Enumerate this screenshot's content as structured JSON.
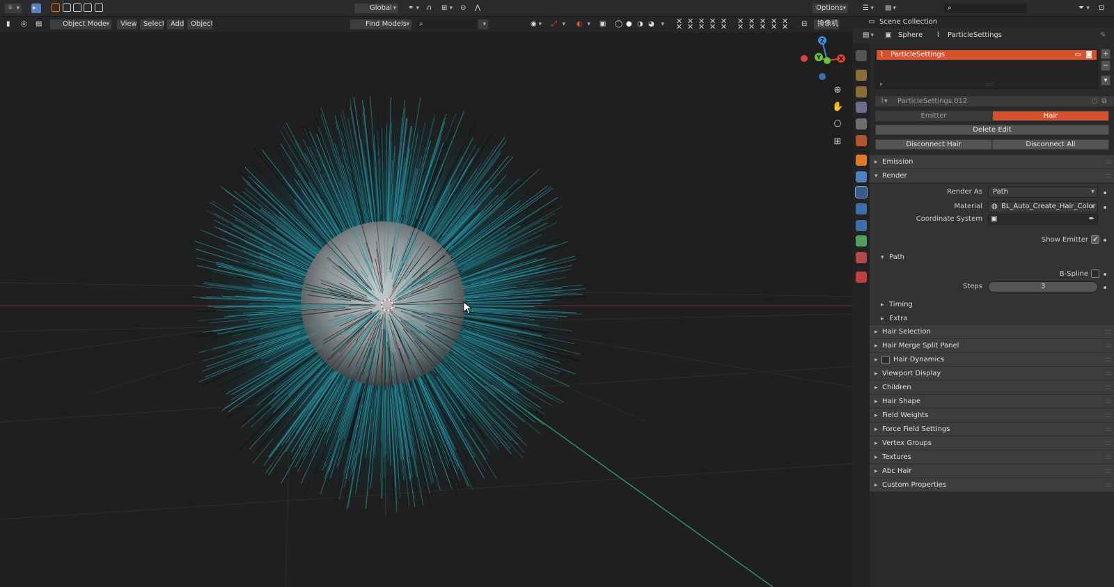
{
  "top_header": {
    "transform_orientation": "Global",
    "options_label": "Options"
  },
  "viewport_header": {
    "mode": "Object Mode",
    "menus": [
      "View",
      "Select",
      "Add",
      "Object"
    ],
    "find_models": "Find Models",
    "camera_label": "換像机"
  },
  "outliner": {
    "scene_collection": "Scene Collection"
  },
  "properties": {
    "breadcrumb_object": "Sphere",
    "breadcrumb_settings": "ParticleSettings",
    "particle_system_list": [
      "ParticleSettings"
    ],
    "particle_settings_name": "ParticleSettings.012",
    "type_options": [
      "Emitter",
      "Hair"
    ],
    "delete_edit": "Delete Edit",
    "disconnect_hair": "Disconnect Hair",
    "disconnect_all": "Disconnect All",
    "panels": {
      "emission": "Emission",
      "render": "Render",
      "hair_selection": "Hair Selection",
      "hair_merge_split": "Hair Merge Split Panel",
      "hair_dynamics": "Hair Dynamics",
      "viewport_display": "Viewport Display",
      "children": "Children",
      "hair_shape": "Hair Shape",
      "field_weights": "Field Weights",
      "force_field_settings": "Force Field Settings",
      "vertex_groups": "Vertex Groups",
      "textures": "Textures",
      "abc_hair": "Abc Hair",
      "custom_properties": "Custom Properties"
    },
    "render": {
      "render_as_label": "Render As",
      "render_as_value": "Path",
      "material_label": "Material",
      "material_value": "BL_Auto_Create_Hair_Color",
      "coordinate_system_label": "Coordinate System",
      "show_emitter_label": "Show Emitter",
      "show_emitter": true,
      "path_label": "Path",
      "bspline_label": "B-Spline",
      "bspline": false,
      "steps_label": "Steps",
      "steps_value": "3",
      "timing_label": "Timing",
      "extra_label": "Extra"
    }
  },
  "colors": {
    "accent_active": "#d4522e",
    "hair_color": "#2a8fa0",
    "axis_x": "#d9443f",
    "axis_y": "#6bbf3f",
    "axis_z": "#3f8fd9"
  }
}
